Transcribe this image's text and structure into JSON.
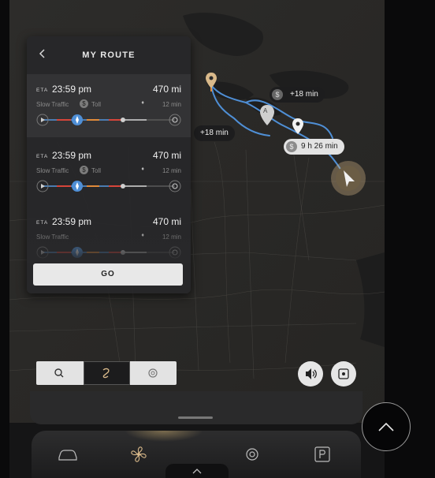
{
  "panel": {
    "title": "MY ROUTE",
    "back_icon": "chevron-left-icon",
    "go_label": "GO"
  },
  "routes": [
    {
      "eta_label": "ETA",
      "eta_time": "23:59 pm",
      "distance": "470 mi",
      "traffic": "Slow Traffic",
      "toll_icon": "$",
      "toll": "Toll",
      "remaining": "12 min",
      "selected": true
    },
    {
      "eta_label": "ETA",
      "eta_time": "23:59 pm",
      "distance": "470 mi",
      "traffic": "Slow Traffic",
      "toll_icon": "$",
      "toll": "Toll",
      "remaining": "12 min",
      "selected": false
    },
    {
      "eta_label": "ETA",
      "eta_time": "23:59 pm",
      "distance": "470 mi",
      "traffic": "Slow Traffic",
      "toll_icon": "",
      "toll": "",
      "remaining": "12 min",
      "selected": false
    }
  ],
  "map": {
    "bubble_top": "+18 min",
    "bubble_left": "+18 min",
    "bubble_main": "9 h 26 min",
    "dollar_sign": "$",
    "waypoint_label": "A",
    "colors": {
      "route": "#4f8fd6",
      "traffic_red": "#d6453a",
      "traffic_orange": "#e08a3a",
      "origin_pin": "#d9b98a"
    }
  },
  "bottom_bar": {
    "tabs": [
      "search-icon",
      "navigation-icon",
      "settings-icon"
    ],
    "active_tab": "navigation-icon",
    "volume_icon": "speaker-icon",
    "recenter_icon": "recenter-icon"
  },
  "dock": {
    "items": [
      "car-icon",
      "fan-icon",
      "settings-icon",
      "parking-assist-icon"
    ],
    "up_icon": "chevron-up-icon"
  },
  "scroll_up_icon": "chevron-up-icon"
}
